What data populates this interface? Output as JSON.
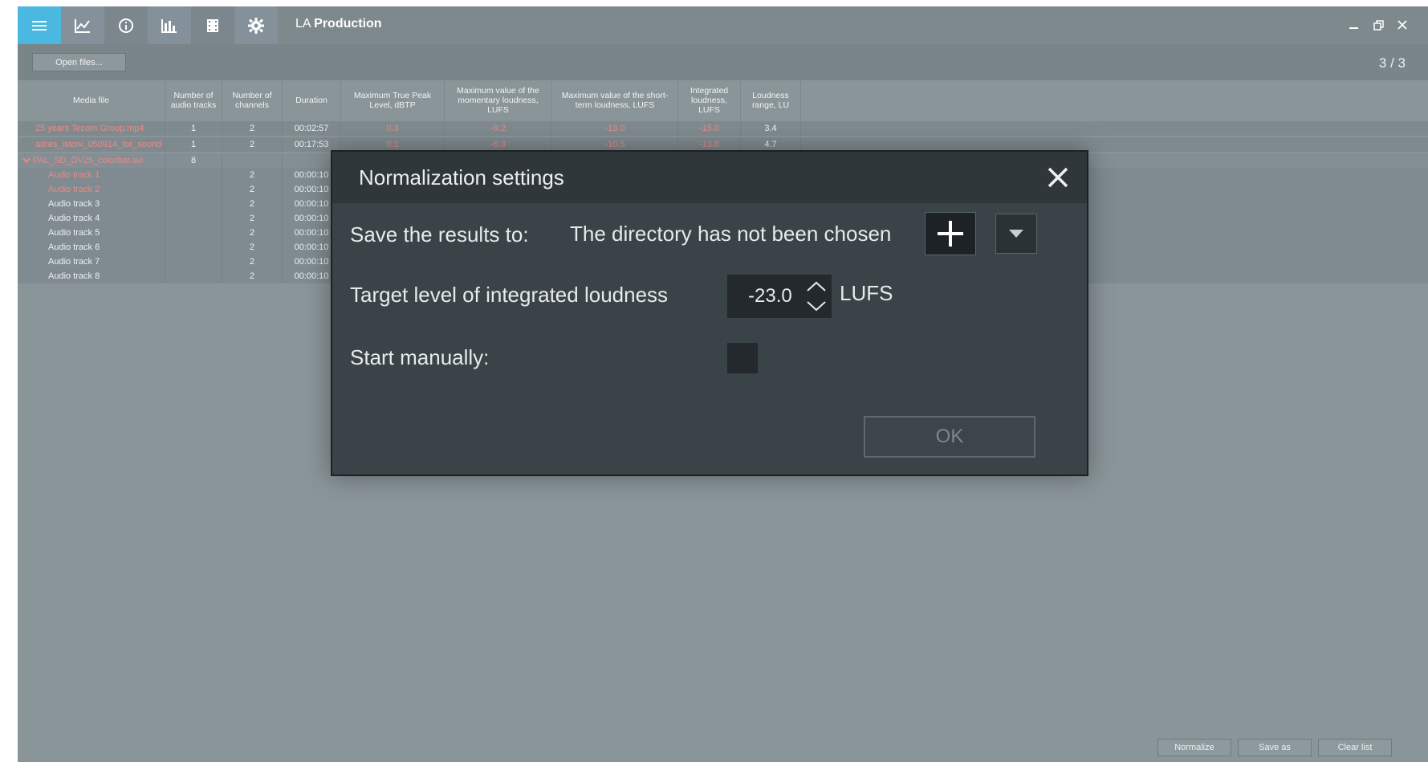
{
  "app": {
    "title_prefix": "LA",
    "title_bold": "Production"
  },
  "toolbar": {
    "open_files": "Open files...",
    "page_counter": "3 / 3"
  },
  "table": {
    "headers": [
      "Media file",
      "Number of audio tracks",
      "Number of channels",
      "Duration",
      "Maximum True Peak Level, dBTP",
      "Maximum value of the momentary loudness, LUFS",
      "Maximum value of the short-term loudness, LUFS",
      "Integrated loudness, LUFS",
      "Loudness range, LU"
    ],
    "rows": [
      {
        "file": "25 years Tecom Group.mp4",
        "tracks": "1",
        "channels": "2",
        "duration": "00:02:57",
        "peak": "0.3",
        "momentary": "-9.2",
        "short_term": "-13.0",
        "integrated": "-15.0",
        "range": "3.4"
      },
      {
        "file": "adres_istoni_050914_for_sound",
        "tracks": "1",
        "channels": "2",
        "duration": "00:17:53",
        "peak": "0.1",
        "momentary": "-6.3",
        "short_term": "-10.5",
        "integrated": "-13.8",
        "range": "4.7"
      }
    ],
    "group": {
      "file": "PAL_SD_DV25_colorbar.avi",
      "tracks": "8"
    },
    "subrows": [
      {
        "file": "Audio track 1",
        "channels": "2",
        "duration": "00:00:10"
      },
      {
        "file": "Audio track 2",
        "channels": "2",
        "duration": "00:00:10"
      },
      {
        "file": "Audio track 3",
        "channels": "2",
        "duration": "00:00:10"
      },
      {
        "file": "Audio track 4",
        "channels": "2",
        "duration": "00:00:10"
      },
      {
        "file": "Audio track 5",
        "channels": "2",
        "duration": "00:00:10"
      },
      {
        "file": "Audio track 6",
        "channels": "2",
        "duration": "00:00:10"
      },
      {
        "file": "Audio track 7",
        "channels": "2",
        "duration": "00:00:10"
      },
      {
        "file": "Audio track 8",
        "channels": "2",
        "duration": "00:00:10"
      }
    ]
  },
  "bottom": {
    "normalize": "Normalize",
    "save_as": "Save as",
    "clear_list": "Clear list"
  },
  "dialog": {
    "title": "Normalization settings",
    "save_label": "Save the results to:",
    "save_path": "The directory has not been chosen",
    "target_label": "Target level of integrated loudness",
    "target_value": "-23.0",
    "target_unit": "LUFS",
    "start_label": "Start manually:",
    "ok": "OK"
  },
  "colors": {
    "accent": "#4ab8e0",
    "error_text": "#e98a86",
    "dialog_bg": "#3a4347"
  }
}
